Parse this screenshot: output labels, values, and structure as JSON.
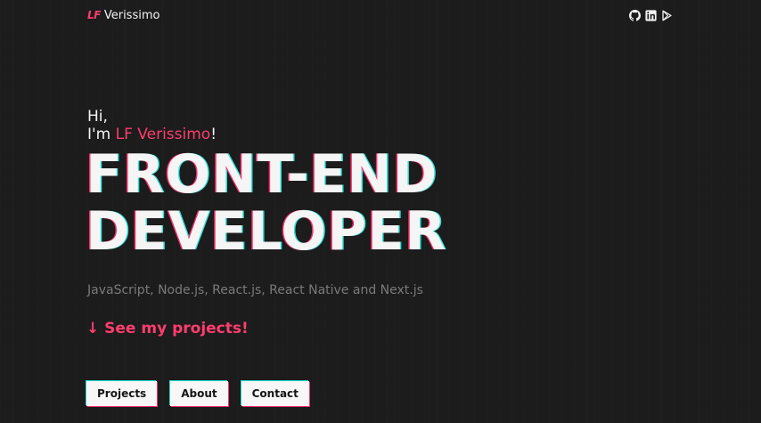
{
  "header": {
    "logo_mark": "LF",
    "logo_name": "Verissimo",
    "social": [
      {
        "icon": "github-icon"
      },
      {
        "icon": "linkedin-icon"
      },
      {
        "icon": "google-play-icon"
      }
    ]
  },
  "hero": {
    "greeting": "Hi,",
    "intro_prefix": "I'm",
    "intro_name": "LF Verissimo",
    "intro_suffix": "!",
    "headline_line1": "FRONT-END",
    "headline_line2": "DEVELOPER",
    "stack": "JavaScript, Node.js, React.js, React Native and Next.js",
    "cta": "↓ See my projects!"
  },
  "nav": {
    "projects_label": "Projects",
    "about_label": "About",
    "contact_label": "Contact"
  },
  "colors": {
    "background": "#1c1c1c",
    "accent": "#ff3d6e",
    "text": "#f3f3f3",
    "muted": "#7a7a7a",
    "glitch_cyan": "#25e0d6",
    "glitch_pink": "#ff2d6b"
  }
}
